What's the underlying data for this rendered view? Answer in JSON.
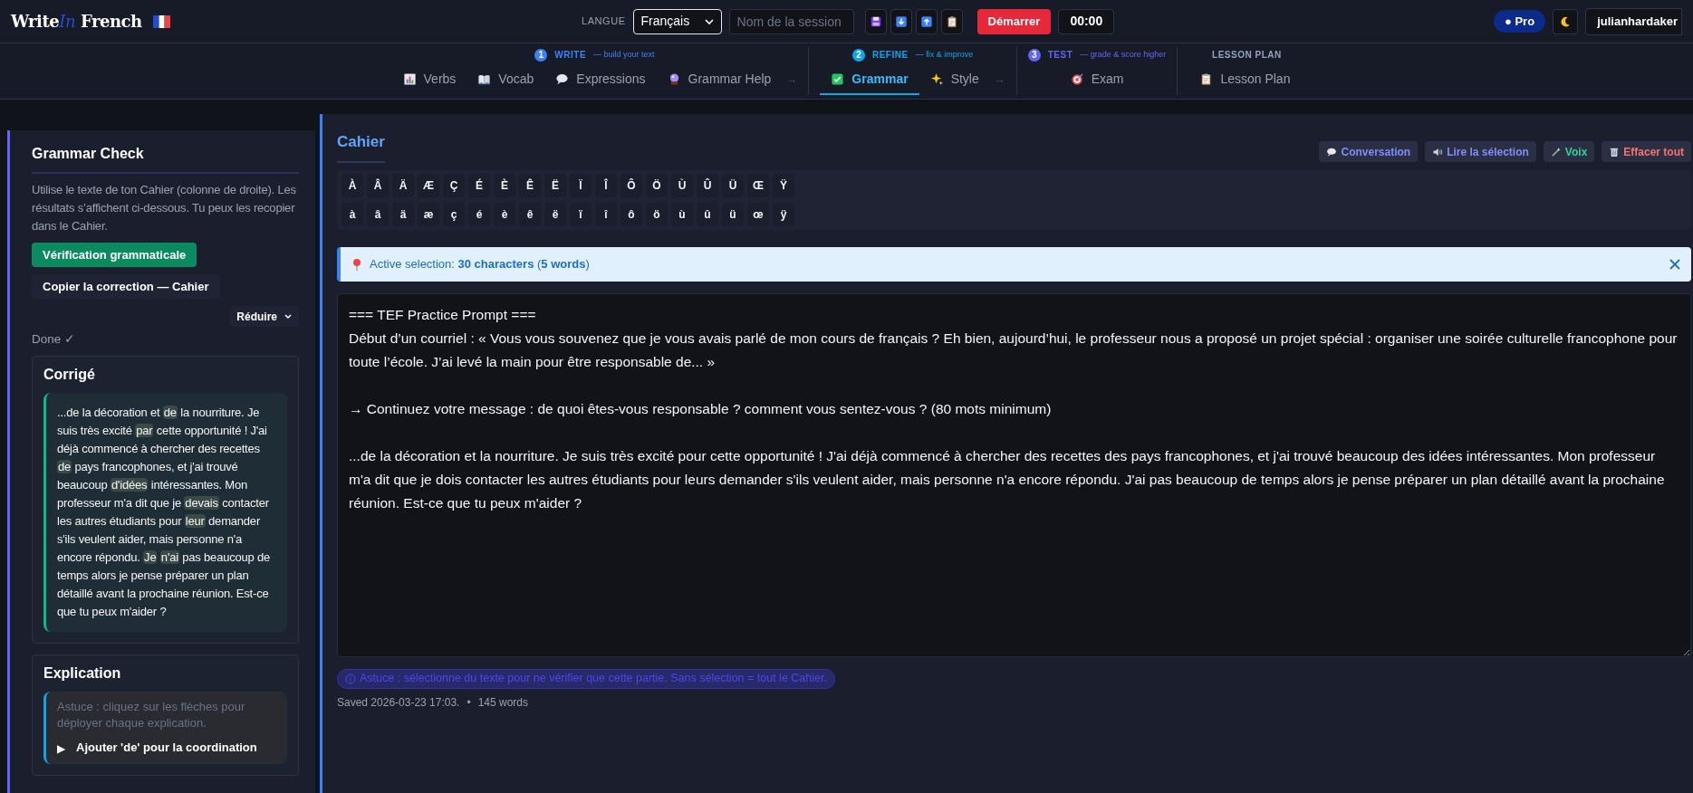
{
  "brand": {
    "part1": "Write",
    "part2": "In",
    "part3": "French"
  },
  "header": {
    "language_label": "LANGUE",
    "language": "Français",
    "session_placeholder": "Nom de la session",
    "start_button": "Démarrer",
    "timer": "00:00",
    "plan_badge": "● Pro",
    "user": "julianhardaker"
  },
  "nav_groups": [
    {
      "number": "1",
      "title": "WRITE",
      "subtitle": "— build your text",
      "color": "#3b82f6",
      "items": [
        {
          "label": "Verbs",
          "kind": "chart",
          "selected": false
        },
        {
          "label": "Vocab",
          "kind": "book",
          "selected": false
        },
        {
          "label": "Expressions",
          "kind": "bubble",
          "selected": false
        },
        {
          "label": "Grammar Help",
          "kind": "ball",
          "selected": false
        }
      ],
      "arrow": "→"
    },
    {
      "number": "2",
      "title": "REFINE",
      "subtitle": "— fix & improve",
      "color": "#0ea5e9",
      "items": [
        {
          "label": "Grammar",
          "kind": "check",
          "selected": true
        },
        {
          "label": "Style",
          "kind": "sparkle",
          "selected": false
        }
      ],
      "arrow": "→"
    },
    {
      "number": "3",
      "title": "TEST",
      "subtitle": "— grade & score higher",
      "color": "#6366f1",
      "items": [
        {
          "label": "Exam",
          "kind": "target",
          "selected": false
        }
      ]
    },
    {
      "title": "LESSON PLAN",
      "items": [
        {
          "label": "Lesson Plan",
          "kind": "clipboard",
          "selected": false
        }
      ]
    }
  ],
  "sidebar": {
    "title": "Grammar Check",
    "intro": "Utilise le texte de ton Cahier (colonne de droite). Les résultats s’affichent ci-dessous. Tu peux les recopier dans le Cahier.",
    "check_button": "Vérification grammaticale",
    "copy_button": "Copier la correction — Cahier",
    "collapse_button": "Réduire",
    "status": "Done ✓",
    "corrected": {
      "title": "Corrigé",
      "segments": [
        {
          "text": "...de la décoration et ",
          "highlighted": false
        },
        {
          "text": "de",
          "highlighted": true
        },
        {
          "text": " la nourriture. Je suis très excité ",
          "highlighted": false
        },
        {
          "text": "par",
          "highlighted": true
        },
        {
          "text": " cette opportunité ! J'ai déjà commencé à chercher des recettes ",
          "highlighted": false
        },
        {
          "text": "de",
          "highlighted": true
        },
        {
          "text": " pays francophones, et j'ai trouvé beaucoup ",
          "highlighted": false
        },
        {
          "text": "d'idées",
          "highlighted": true
        },
        {
          "text": " intéressantes. Mon professeur m'a dit que je ",
          "highlighted": false
        },
        {
          "text": "devais",
          "highlighted": true
        },
        {
          "text": " contacter les autres étudiants pour ",
          "highlighted": false
        },
        {
          "text": "leur",
          "highlighted": true
        },
        {
          "text": " demander s'ils veulent aider, mais personne n'a encore répondu. ",
          "highlighted": false
        },
        {
          "text": "Je ",
          "highlighted": true
        },
        {
          "text": "n'ai",
          "highlighted": true
        },
        {
          "text": " pas beaucoup de temps alors je pense préparer un plan détaillé avant la prochaine réunion. Est-ce que tu peux m'aider ?",
          "highlighted": false
        }
      ]
    },
    "explanation": {
      "title": "Explication",
      "hint": "Astuce : cliquez sur les flèches pour déployer chaque explication.",
      "items": [
        {
          "arrow": "▶",
          "label": "Ajouter 'de' pour la coordination"
        }
      ]
    }
  },
  "main": {
    "title": "Cahier",
    "actions": [
      {
        "label": "Conversation",
        "kind": "chat"
      },
      {
        "label": "Lire la sélection",
        "kind": "speaker"
      },
      {
        "label": "Voix",
        "kind": "wand"
      },
      {
        "label": "Effacer tout",
        "kind": "trash"
      }
    ],
    "accents_upper": [
      "À",
      "Â",
      "Ä",
      "Æ",
      "Ç",
      "É",
      "È",
      "Ê",
      "Ë",
      "Ï",
      "Î",
      "Ô",
      "Ö",
      "Ù",
      "Û",
      "Ü",
      "Œ",
      "Ÿ"
    ],
    "accents_lower": [
      "à",
      "â",
      "ä",
      "æ",
      "ç",
      "é",
      "è",
      "ê",
      "ë",
      "ï",
      "î",
      "ô",
      "ö",
      "ù",
      "û",
      "ü",
      "œ",
      "ÿ"
    ],
    "selection_banner": "Active selection: **30 characters** (**5 words**)",
    "notebook_text": "=== TEF Practice Prompt ===\nDébut d’un courriel : « Vous vous souvenez que je vous avais parlé de mon cours de français ? Eh bien, aujourd’hui, le professeur nous a proposé un projet spécial : organiser une soirée culturelle francophone pour toute l’école. J’ai levé la main pour être responsable de... »\n\n→ Continuez votre message : de quoi êtes-vous responsable ? comment vous sentez-vous ? (80 mots minimum)\n\n...de la décoration et la nourriture. Je suis très excité pour cette opportunité ! J'ai déjà commencé à chercher des recettes des pays francophones, et j'ai trouvé beaucoup des idées intéressantes. Mon professeur m'a dit que je dois contacter les autres étudiants pour leurs demander s'ils veulent aider, mais personne n'a encore répondu. J'ai pas beaucoup de temps alors je pense préparer un plan détaillé avant la prochaine réunion. Est-ce que tu peux m'aider ?",
    "tip": "Astuce : sélectionne du texte pour ne vérifier que cette partie. Sans sélection = tout le Cahier.",
    "saved": "Saved 2026-03-23 17:03.",
    "separator": "•",
    "word_count": "145 words"
  }
}
